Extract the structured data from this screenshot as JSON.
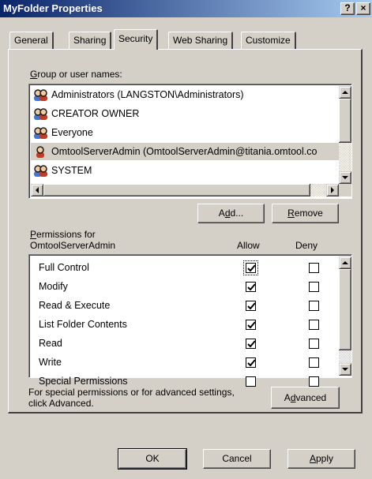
{
  "window": {
    "title": "MyFolder Properties",
    "help_label": "?",
    "close_label": "×"
  },
  "tabs": [
    {
      "label": "General",
      "active": false
    },
    {
      "label": "Sharing",
      "active": false
    },
    {
      "label": "Security",
      "active": true
    },
    {
      "label": "Web Sharing",
      "active": false
    },
    {
      "label": "Customize",
      "active": false
    }
  ],
  "group_label": "Group or user names:",
  "users": [
    {
      "name": "Administrators (LANGSTON\\Administrators)",
      "icon": "user-group-icon",
      "selected": false
    },
    {
      "name": "CREATOR OWNER",
      "icon": "user-group-icon",
      "selected": false
    },
    {
      "name": "Everyone",
      "icon": "user-group-icon",
      "selected": false
    },
    {
      "name": "OmtoolServerAdmin (OmtoolServerAdmin@titania.omtool.co",
      "icon": "user-icon",
      "selected": true
    },
    {
      "name": "SYSTEM",
      "icon": "user-group-icon",
      "selected": false
    }
  ],
  "buttons": {
    "add": "Add...",
    "remove": "Remove",
    "advanced": "Advanced",
    "ok": "OK",
    "cancel": "Cancel",
    "apply": "Apply"
  },
  "permissions": {
    "header_line1": "Permissions for",
    "header_line2": "OmtoolServerAdmin",
    "allow_label": "Allow",
    "deny_label": "Deny",
    "rows": [
      {
        "name": "Full Control",
        "allow": true,
        "deny": false
      },
      {
        "name": "Modify",
        "allow": true,
        "deny": false
      },
      {
        "name": "Read & Execute",
        "allow": true,
        "deny": false
      },
      {
        "name": "List Folder Contents",
        "allow": true,
        "deny": false
      },
      {
        "name": "Read",
        "allow": true,
        "deny": false
      },
      {
        "name": "Write",
        "allow": true,
        "deny": false
      },
      {
        "name": "Special Permissions",
        "allow": false,
        "deny": false
      }
    ]
  },
  "advanced_text_line1": "For special permissions or for advanced settings,",
  "advanced_text_line2": "click Advanced."
}
